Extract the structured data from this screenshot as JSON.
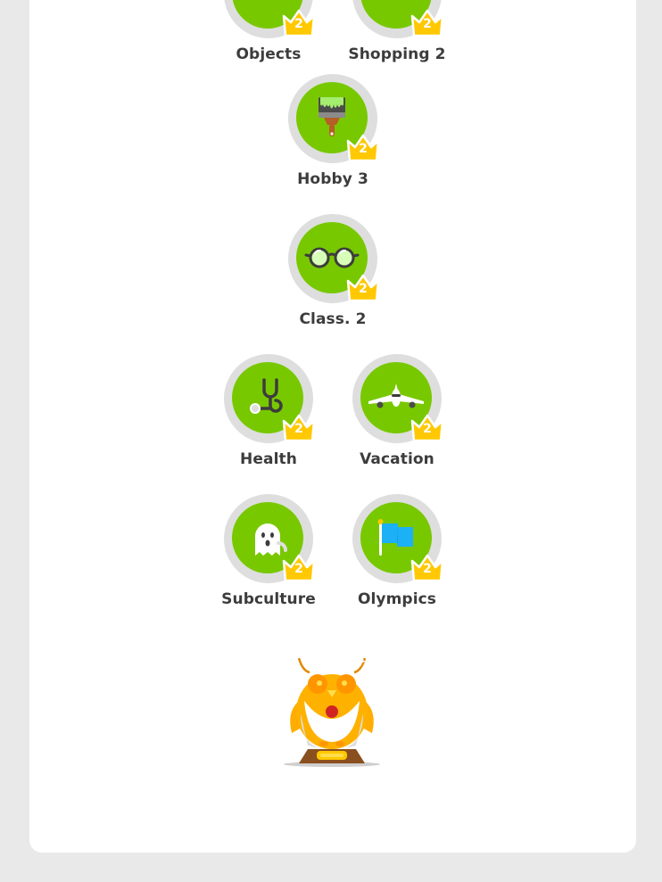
{
  "colors": {
    "skill_green": "#78c800",
    "ring_gray": "#dedede",
    "crown_gold": "#ffc800",
    "page_background": "#e9e9e9",
    "panel_background": "#ffffff"
  },
  "skills": [
    {
      "label": "Objects",
      "crown_level": "2",
      "icon": "objects-icon"
    },
    {
      "label": "Shopping 2",
      "crown_level": "2",
      "icon": "shopping-icon"
    },
    {
      "label": "Hobby 3",
      "crown_level": "2",
      "icon": "paintbrush-icon"
    },
    {
      "label": "Class. 2",
      "crown_level": "2",
      "icon": "glasses-icon"
    },
    {
      "label": "Health",
      "crown_level": "2",
      "icon": "stethoscope-icon"
    },
    {
      "label": "Vacation",
      "crown_level": "2",
      "icon": "airplane-icon"
    },
    {
      "label": "Subculture",
      "crown_level": "2",
      "icon": "ghost-icon"
    },
    {
      "label": "Olympics",
      "crown_level": "2",
      "icon": "flag-icon"
    }
  ],
  "trophy": {
    "icon": "golden-owl-trophy-icon"
  }
}
